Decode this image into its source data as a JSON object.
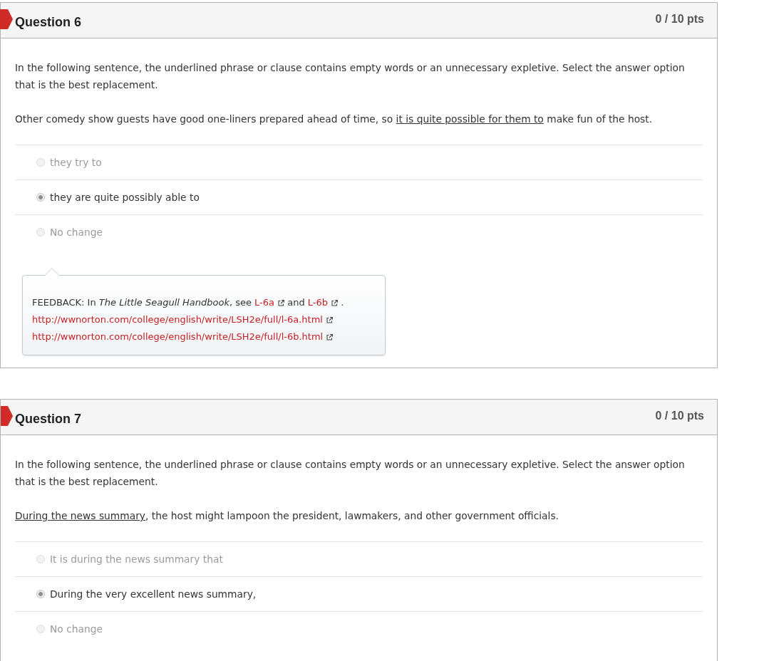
{
  "questions": [
    {
      "title": "Question 6",
      "points": "0 / 10 pts",
      "incorrect": true,
      "instruction": "In the following sentence, the underlined phrase or clause contains empty words or an unnecessary expletive. Select the answer option that is the best replacement.",
      "sentence": {
        "before": "Other comedy show guests have good one-liners prepared ahead of time, so ",
        "underlined": "it is quite possible for them to",
        "after": " make fun of the host."
      },
      "answers": [
        {
          "text": "they try to",
          "selected": false
        },
        {
          "text": "they are quite possibly able to",
          "selected": true
        },
        {
          "text": "No change",
          "selected": false
        }
      ],
      "feedback": {
        "lines": [
          [
            {
              "kind": "text",
              "text": "FEEDBACK: In *The Little Seagull Handbook*, see "
            },
            {
              "kind": "link",
              "text": "L-6a"
            },
            {
              "kind": "text",
              "text": " and "
            },
            {
              "kind": "link",
              "text": "L-6b"
            },
            {
              "kind": "text",
              "text": " ."
            }
          ],
          [
            {
              "kind": "link",
              "text": "http://wwnorton.com/college/english/write/LSH2e/full/l-6a.html"
            }
          ],
          [
            {
              "kind": "link",
              "text": "http://wwnorton.com/college/english/write/LSH2e/full/l-6b.html"
            }
          ]
        ]
      }
    },
    {
      "title": "Question 7",
      "points": "0 / 10 pts",
      "incorrect": true,
      "instruction": "In the following sentence, the underlined phrase or clause contains empty words or an unnecessary expletive. Select the answer option that is the best replacement.",
      "sentence": {
        "underlined": "During the news summary",
        "after": ", the host might lampoon the president, lawmakers, and other government officials."
      },
      "answers": [
        {
          "text": "It is during the news summary that",
          "selected": false
        },
        {
          "text": "During the very excellent news summary,",
          "selected": true
        },
        {
          "text": "No change",
          "selected": false
        }
      ]
    }
  ]
}
